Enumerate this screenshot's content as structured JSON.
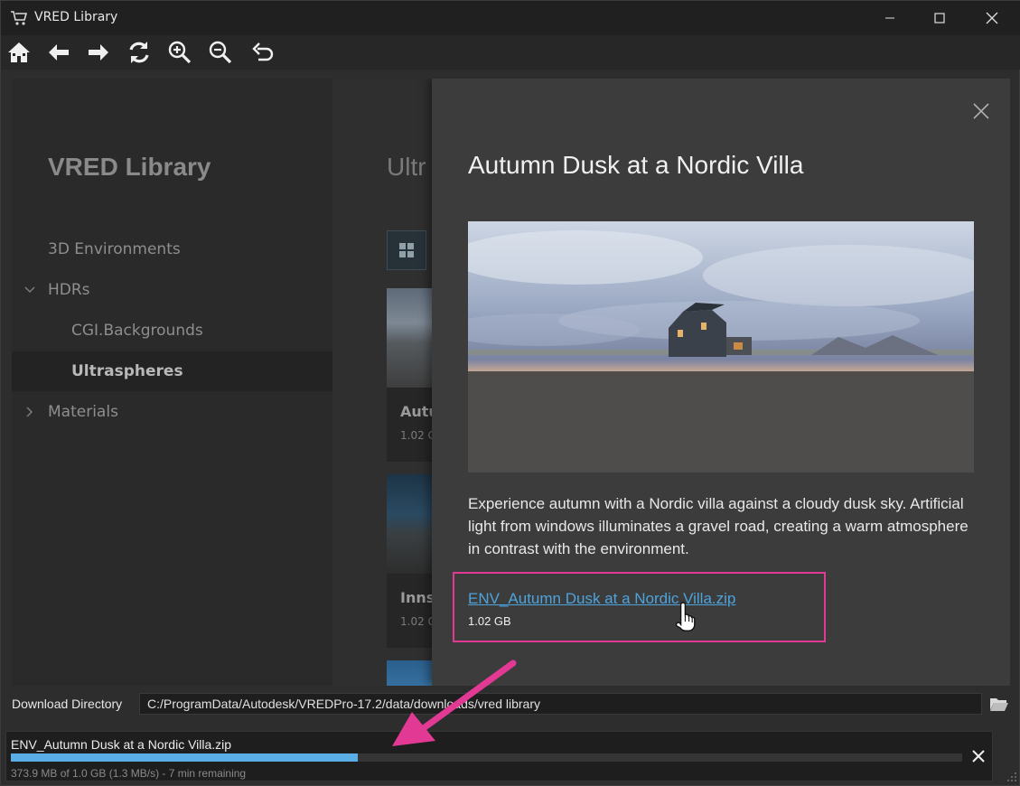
{
  "window": {
    "title": "VRED Library",
    "controls": [
      "minimize-icon",
      "maximize-icon",
      "close-icon"
    ]
  },
  "toolbar": {
    "buttons": [
      "home-icon",
      "back-icon",
      "forward-icon",
      "refresh-icon",
      "zoom-in-icon",
      "zoom-out-icon",
      "undo-icon"
    ]
  },
  "sidebar": {
    "title": "VRED Library",
    "items": [
      {
        "label": "3D Environments"
      },
      {
        "label": "HDRs"
      },
      {
        "label": "CGI.Backgrounds"
      },
      {
        "label": "Ultraspheres"
      },
      {
        "label": "Materials"
      }
    ]
  },
  "main": {
    "heading": "Ultr",
    "cards": [
      {
        "title": "Autu",
        "size": "1.02 G"
      },
      {
        "title": "Inns",
        "size": "1.02 G"
      }
    ]
  },
  "detail": {
    "title": "Autumn Dusk at a Nordic Villa",
    "description": "Experience autumn with a Nordic villa against a cloudy dusk sky. Artificial light from windows illuminates a gravel road, creating a warm atmosphere in contrast with the environment.",
    "file_link": "ENV_Autumn Dusk at a Nordic Villa.zip",
    "file_size": "1.02 GB"
  },
  "download_directory": {
    "label": "Download Directory",
    "path": "C:/ProgramData/Autodesk/VREDPro-17.2/data/downloads/vred library"
  },
  "download": {
    "file_name": "ENV_Autumn Dusk at a Nordic Villa.zip",
    "progress": 0.365,
    "status": "373.9 MB of 1.0 GB (1.3 MB/s) - 7 min remaining"
  },
  "colors": {
    "accent": "#5aaee6",
    "link": "#4da3dc",
    "highlight": "#e23a94"
  }
}
